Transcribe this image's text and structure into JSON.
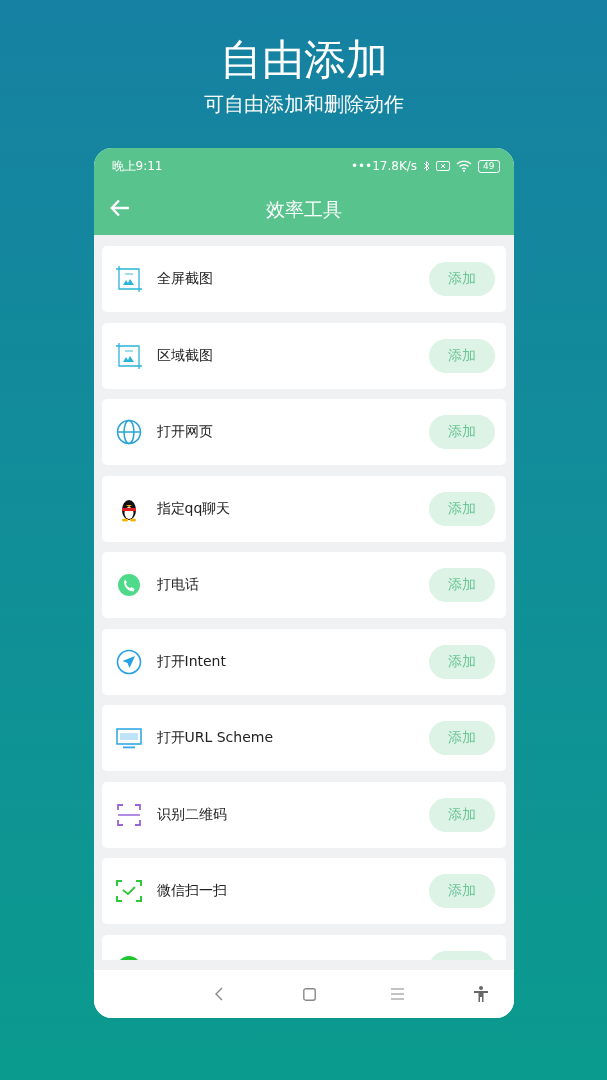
{
  "headline": {
    "title": "自由添加",
    "subtitle": "可自由添加和删除动作"
  },
  "status_bar": {
    "time": "晚上9:11",
    "speed": "•••17.8K/s",
    "battery": "49"
  },
  "header": {
    "title": "效率工具"
  },
  "actions": [
    {
      "kind": "screenshot",
      "label": "全屏截图",
      "button": "添加"
    },
    {
      "kind": "screenshot",
      "label": "区域截图",
      "button": "添加"
    },
    {
      "kind": "web",
      "label": "打开网页",
      "button": "添加"
    },
    {
      "kind": "qq",
      "label": "指定qq聊天",
      "button": "添加"
    },
    {
      "kind": "call",
      "label": "打电话",
      "button": "添加"
    },
    {
      "kind": "intent",
      "label": "打开Intent",
      "button": "添加"
    },
    {
      "kind": "scheme",
      "label": "打开URL Scheme",
      "button": "添加"
    },
    {
      "kind": "qrcode",
      "label": "识别二维码",
      "button": "添加"
    },
    {
      "kind": "wechat",
      "label": "微信扫一扫",
      "button": "添加"
    },
    {
      "kind": "partial"
    }
  ]
}
